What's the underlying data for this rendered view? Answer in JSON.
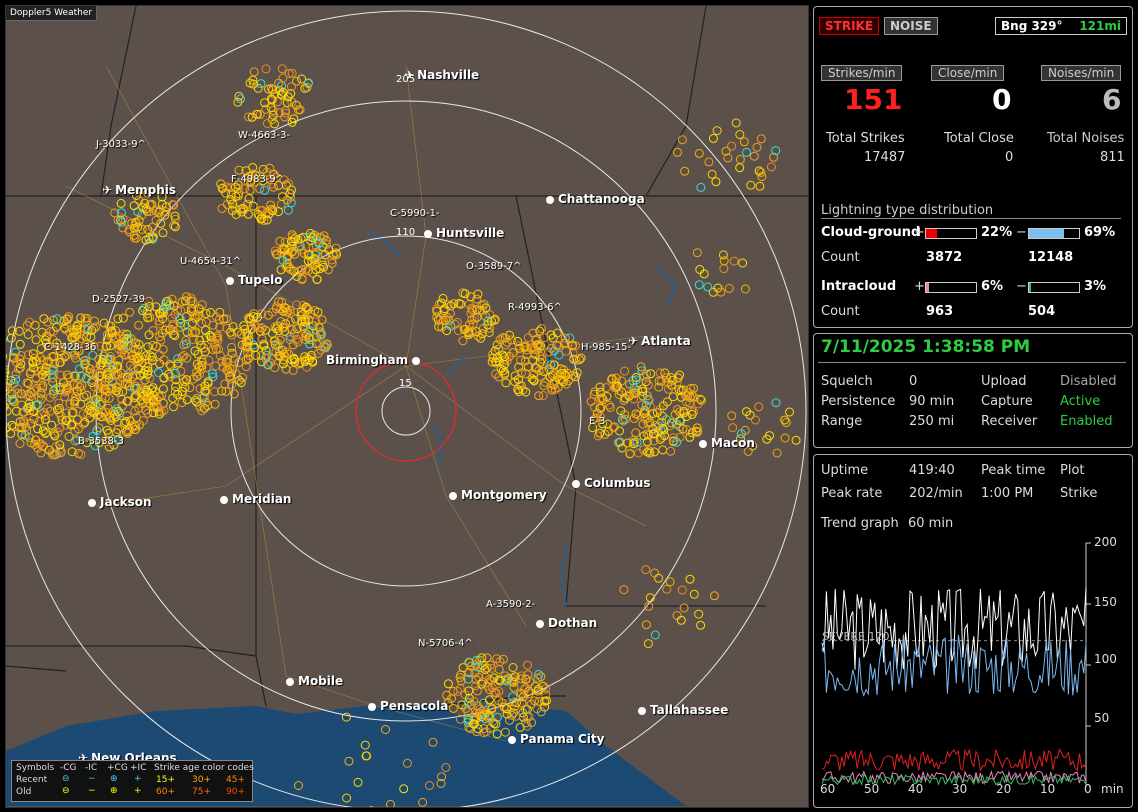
{
  "map": {
    "title": "Doppler5 Weather",
    "cities": [
      {
        "name": "Nashville",
        "icon": "airport-icon"
      },
      {
        "name": "Memphis",
        "icon": "airport-icon"
      },
      {
        "name": "Chattanooga",
        "icon": "dot"
      },
      {
        "name": "Huntsville",
        "icon": "dot"
      },
      {
        "name": "Tupelo",
        "icon": "dot"
      },
      {
        "name": "Atlanta",
        "icon": "airport-icon"
      },
      {
        "name": "Birmingham",
        "icon": "dot"
      },
      {
        "name": "Macon",
        "icon": "dot"
      },
      {
        "name": "Meridian",
        "icon": "dot"
      },
      {
        "name": "Jackson",
        "icon": "dot"
      },
      {
        "name": "Montgomery",
        "icon": "dot"
      },
      {
        "name": "Columbus",
        "icon": "dot"
      },
      {
        "name": "Dothan",
        "icon": "dot"
      },
      {
        "name": "Mobile",
        "icon": "dot"
      },
      {
        "name": "Pensacola",
        "icon": "dot"
      },
      {
        "name": "Tallahassee",
        "icon": "dot"
      },
      {
        "name": "Panama City",
        "icon": "dot"
      },
      {
        "name": "New Orleans",
        "icon": "airport-icon"
      }
    ],
    "cells": [
      "J-3033-9^",
      "W-4663-3-",
      "F-4983-9^",
      "C-5990-1-",
      "U-4654-31^",
      "D-2527-39",
      "O-3589-7^",
      "R-4993-6^",
      "H-985-15-",
      "C-1428-36",
      "E-3",
      "B-3538-3",
      "A-3590-2-",
      "N-5706-4^"
    ],
    "range_labels": [
      "205",
      "110",
      "15"
    ],
    "legend": {
      "row1": [
        "Symbols",
        "-CG",
        "-IC",
        "+CG",
        "+IC",
        "Strike age color codes"
      ],
      "row2_label": "Recent",
      "row2_ages": [
        "15+",
        "30+",
        "45+"
      ],
      "row3_label": "Old",
      "row3_ages": [
        "60+",
        "75+",
        "90+"
      ]
    }
  },
  "status": {
    "strike_btn": "STRIKE",
    "noise_btn": "NOISE",
    "bearing": "Bng 329°",
    "distance": "121mi",
    "rates": [
      {
        "label": "Strikes/min",
        "value": "151",
        "color": "#ff2020"
      },
      {
        "label": "Close/min",
        "value": "0",
        "color": "#ffffff"
      },
      {
        "label": "Noises/min",
        "value": "6",
        "color": "#bbbbbb"
      }
    ],
    "totals": [
      {
        "label": "Total Strikes",
        "value": "17487"
      },
      {
        "label": "Total Close",
        "value": "0"
      },
      {
        "label": "Total Noises",
        "value": "811"
      }
    ],
    "dist_title": "Lightning type distribution",
    "cg": {
      "label": "Cloud-ground",
      "pos_pct": "22%",
      "neg_pct": "69%",
      "pos_fill": 0.22,
      "neg_fill": 0.69,
      "count_label": "Count",
      "pos_count": "3872",
      "neg_count": "12148"
    },
    "ic": {
      "label": "Intracloud",
      "pos_pct": "6%",
      "neg_pct": "3%",
      "pos_fill": 0.06,
      "neg_fill": 0.03,
      "count_label": "Count",
      "pos_count": "963",
      "neg_count": "504"
    },
    "plus": "+",
    "minus": "−"
  },
  "settings": {
    "datetime": "7/11/2025 1:38:58 PM",
    "rows": [
      [
        "Squelch",
        "0",
        "Upload",
        "Disabled"
      ],
      [
        "Persistence",
        "90 min",
        "Capture",
        "Active"
      ],
      [
        "Range",
        "250 mi",
        "Receiver",
        "Enabled"
      ]
    ]
  },
  "stats": {
    "uptime_label": "Uptime",
    "uptime": "419:40",
    "peak_time_label": "Peak time",
    "plot_label": "Plot",
    "peak_rate_label": "Peak rate",
    "peak_rate": "202/min",
    "peak_time": "1:00 PM",
    "plot_value": "Strike",
    "trend_label": "Trend graph",
    "trend_value": "60 min",
    "severe_label": "SEVERE 120",
    "y_ticks": [
      "200",
      "150",
      "100",
      "50"
    ],
    "x_ticks": [
      "60",
      "50",
      "40",
      "30",
      "20",
      "10",
      "0"
    ],
    "x_unit": "min"
  },
  "chart_data": {
    "type": "line",
    "x_unit": "min",
    "xlim": [
      60,
      0
    ],
    "ylim": [
      0,
      200
    ],
    "series": [],
    "threshold": {
      "label": "SEVERE 120",
      "value": 120
    }
  }
}
